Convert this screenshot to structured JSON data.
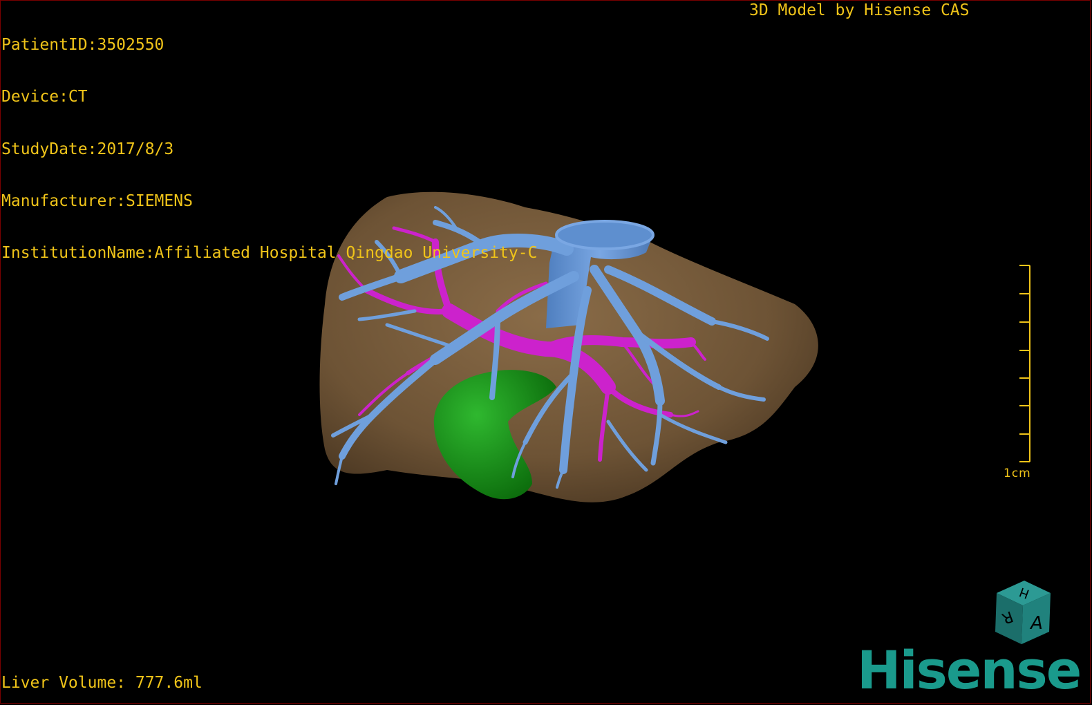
{
  "header": {
    "patient_id": "PatientID:3502550",
    "device": "Device:CT",
    "study_date": "StudyDate:2017/8/3",
    "manufacturer": "Manufacturer:SIEMENS",
    "institution": "InstitutionName:Affiliated Hospital Qingdao University-C",
    "model_credit": "3D Model by Hisense CAS"
  },
  "footer": {
    "liver_volume": "Liver Volume: 777.6ml"
  },
  "scale": {
    "label": "1cm"
  },
  "orientation_cube": {
    "face_front": "A",
    "face_top": "H",
    "face_side": "R"
  },
  "brand": {
    "logo_text": "Hisense"
  },
  "colors": {
    "overlay_text": "#f0c419",
    "liver": "#7a5f3e",
    "hepatic_veins": "#6f9fdc",
    "portal_vein": "#cc22cc",
    "gallbladder": "#1a8a1a",
    "brand": "#1a9a8c",
    "background": "#000000"
  }
}
